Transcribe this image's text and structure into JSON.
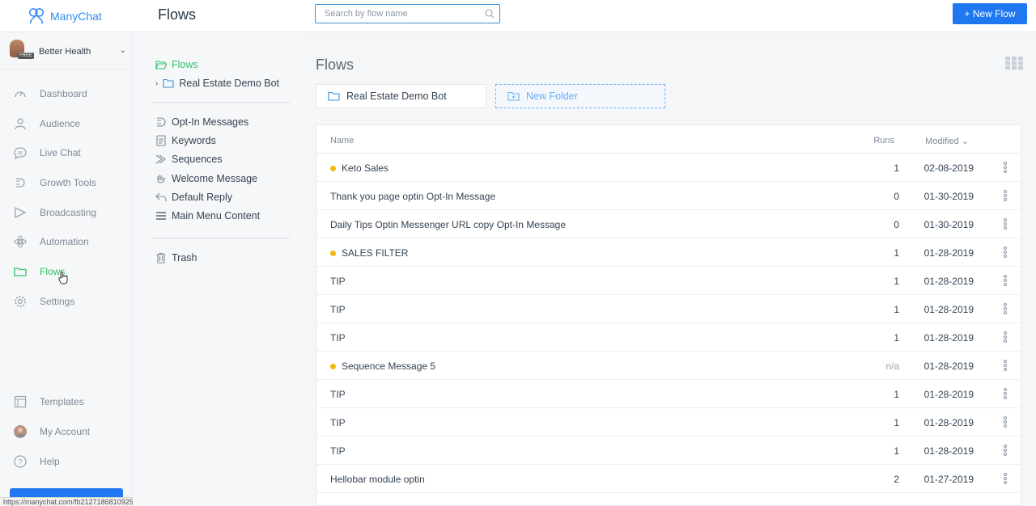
{
  "app": {
    "brand_name": "ManyChat",
    "brand_color": "#2d8cf0",
    "accent_green": "#34c16a",
    "primary_blue": "#1f78f0"
  },
  "account": {
    "name": "Better Health",
    "plan_badge": "FREE"
  },
  "sidebar": {
    "items": [
      {
        "label": "Dashboard",
        "icon": "dashboard-icon"
      },
      {
        "label": "Audience",
        "icon": "person-icon"
      },
      {
        "label": "Live Chat",
        "icon": "chat-bubble-icon"
      },
      {
        "label": "Growth Tools",
        "icon": "growth-tools-icon"
      },
      {
        "label": "Broadcasting",
        "icon": "send-icon"
      },
      {
        "label": "Automation",
        "icon": "automation-icon"
      },
      {
        "label": "Flows",
        "icon": "folder-icon",
        "active": true
      },
      {
        "label": "Settings",
        "icon": "gear-icon"
      }
    ],
    "bottom": [
      {
        "label": "Templates",
        "icon": "templates-icon"
      },
      {
        "label": "My Account",
        "icon": "avatar-icon"
      },
      {
        "label": "Help",
        "icon": "help-icon"
      }
    ]
  },
  "status_bar": {
    "url": "https://manychat.com/fb2127186810925736/cms"
  },
  "header": {
    "title": "Flows",
    "search_placeholder": "Search by flow name",
    "new_flow_label": "+ New Flow"
  },
  "folders": {
    "root_label": "Flows",
    "subfolder_label": "Real Estate Demo Bot",
    "system_items": [
      {
        "label": "Opt-In Messages",
        "icon": "opt-in-icon"
      },
      {
        "label": "Keywords",
        "icon": "keywords-icon"
      },
      {
        "label": "Sequences",
        "icon": "sequences-icon"
      },
      {
        "label": "Welcome Message",
        "icon": "wave-icon"
      },
      {
        "label": "Default Reply",
        "icon": "reply-icon"
      },
      {
        "label": "Main Menu Content",
        "icon": "menu-icon"
      }
    ],
    "trash_label": "Trash"
  },
  "main": {
    "title": "Flows",
    "folder_cards": [
      {
        "label": "Real Estate Demo Bot"
      },
      {
        "label": "New Folder"
      }
    ],
    "table": {
      "columns": {
        "name": "Name",
        "runs": "Runs",
        "modified": "Modified"
      },
      "rows": [
        {
          "name": "Keto Sales",
          "dot": true,
          "runs": "1",
          "modified": "02-08-2019"
        },
        {
          "name": "Thank you page optin Opt-In Message",
          "dot": false,
          "runs": "0",
          "modified": "01-30-2019"
        },
        {
          "name": "Daily Tips Optin Messenger URL copy Opt-In Message",
          "dot": false,
          "runs": "0",
          "modified": "01-30-2019"
        },
        {
          "name": "SALES FILTER",
          "dot": true,
          "runs": "1",
          "modified": "01-28-2019"
        },
        {
          "name": "TIP",
          "dot": false,
          "runs": "1",
          "modified": "01-28-2019"
        },
        {
          "name": "TIP",
          "dot": false,
          "runs": "1",
          "modified": "01-28-2019"
        },
        {
          "name": "TIP",
          "dot": false,
          "runs": "1",
          "modified": "01-28-2019"
        },
        {
          "name": "Sequence Message 5",
          "dot": true,
          "runs": "n/a",
          "modified": "01-28-2019"
        },
        {
          "name": "TIP",
          "dot": false,
          "runs": "1",
          "modified": "01-28-2019"
        },
        {
          "name": "TIP",
          "dot": false,
          "runs": "1",
          "modified": "01-28-2019"
        },
        {
          "name": "TIP",
          "dot": false,
          "runs": "1",
          "modified": "01-28-2019"
        },
        {
          "name": "Hellobar module optin",
          "dot": false,
          "runs": "2",
          "modified": "01-27-2019"
        }
      ]
    }
  }
}
